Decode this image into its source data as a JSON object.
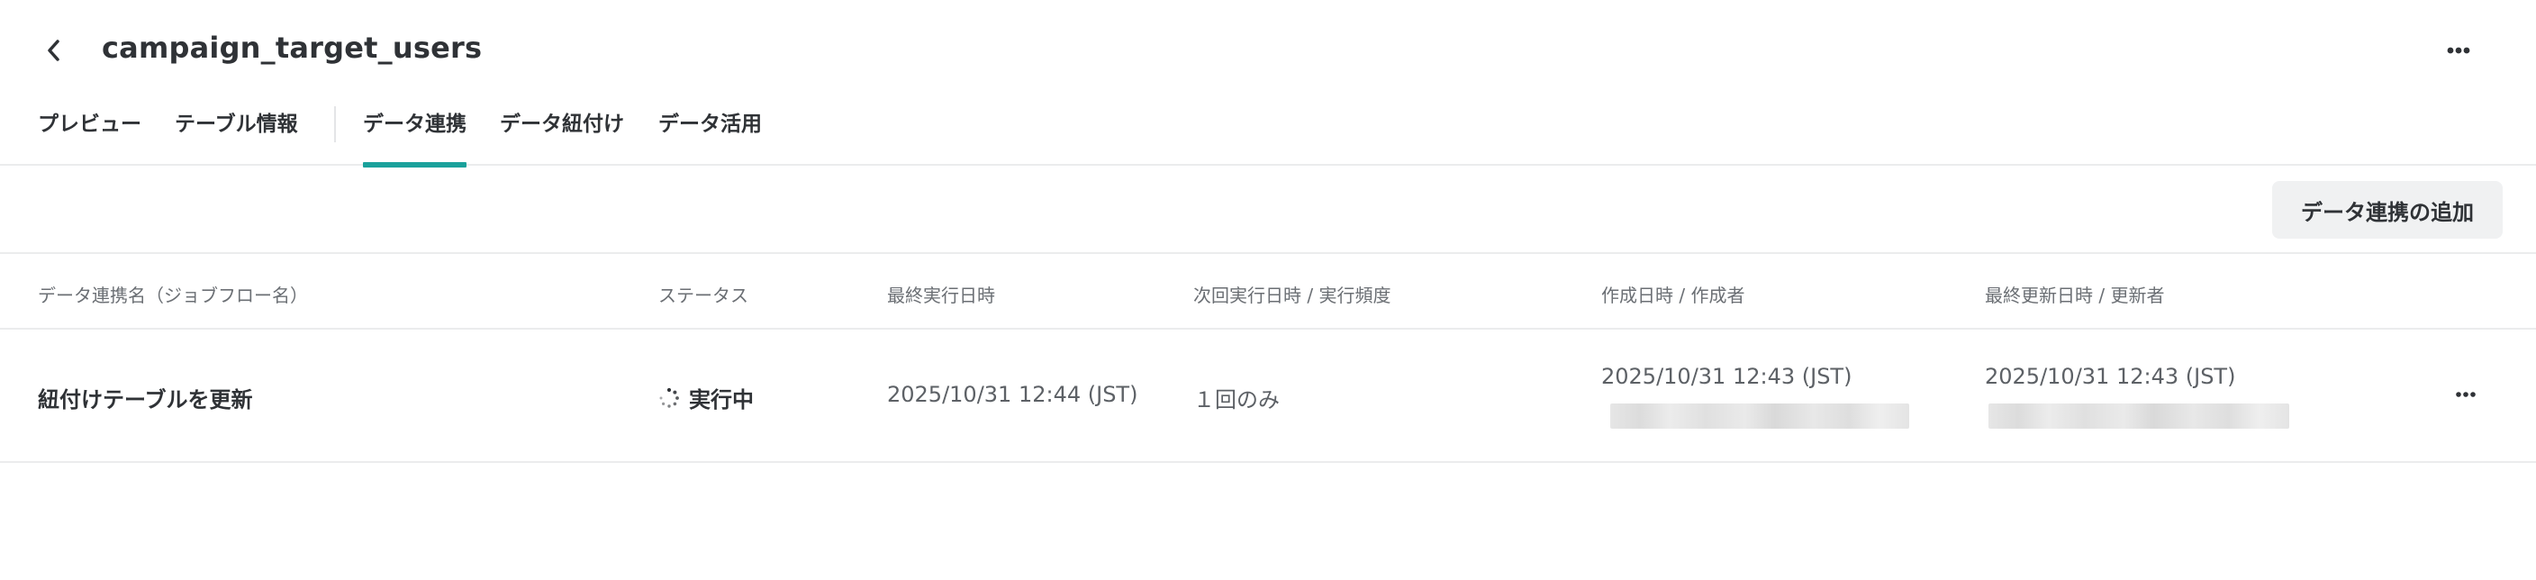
{
  "header": {
    "back_icon": "chevron-left-icon",
    "title": "campaign_target_users",
    "more_icon": "more-horizontal-icon"
  },
  "tabs": [
    {
      "label": "プレビュー",
      "active": false
    },
    {
      "label": "テーブル情報",
      "active": false
    },
    {
      "label": "データ連携",
      "active": true
    },
    {
      "label": "データ紐付け",
      "active": false
    },
    {
      "label": "データ活用",
      "active": false
    }
  ],
  "toolbar": {
    "add_button_label": "データ連携の追加"
  },
  "table": {
    "columns": [
      "データ連携名（ジョブフロー名）",
      "ステータス",
      "最終実行日時",
      "次回実行日時 / 実行頻度",
      "作成日時 / 作成者",
      "最終更新日時 / 更新者"
    ],
    "rows": [
      {
        "name": "紐付けテーブルを更新",
        "status": "実行中",
        "status_icon": "spinner-icon",
        "last_run": "2025/10/31 12:44 (JST)",
        "next_run": "１回のみ",
        "created_at": "2025/10/31 12:43 (JST)",
        "updated_at": "2025/10/31 12:43 (JST)",
        "more_icon": "more-horizontal-icon"
      }
    ]
  },
  "colors": {
    "accent": "#1aa19b",
    "text": "#2f3236",
    "muted": "#6b6f74",
    "border": "#ebeced",
    "button_bg": "#f0f1f2"
  }
}
